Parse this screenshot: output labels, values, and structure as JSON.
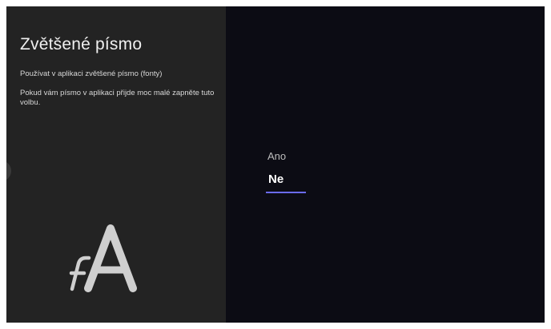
{
  "setting": {
    "title": "Zvětšené písmo",
    "subtitle": "Používat v aplikaci zvětšené písmo (fonty)",
    "description": "Pokud vám písmo v aplikaci přijde moc malé zapněte tuto volbu.",
    "icon": "font-size-icon"
  },
  "options": [
    {
      "label": "Ano",
      "selected": false
    },
    {
      "label": "Ne",
      "selected": true
    }
  ],
  "colors": {
    "left_panel": "#232323",
    "right_panel": "#0c0c14",
    "accent": "#6b6cf5"
  }
}
